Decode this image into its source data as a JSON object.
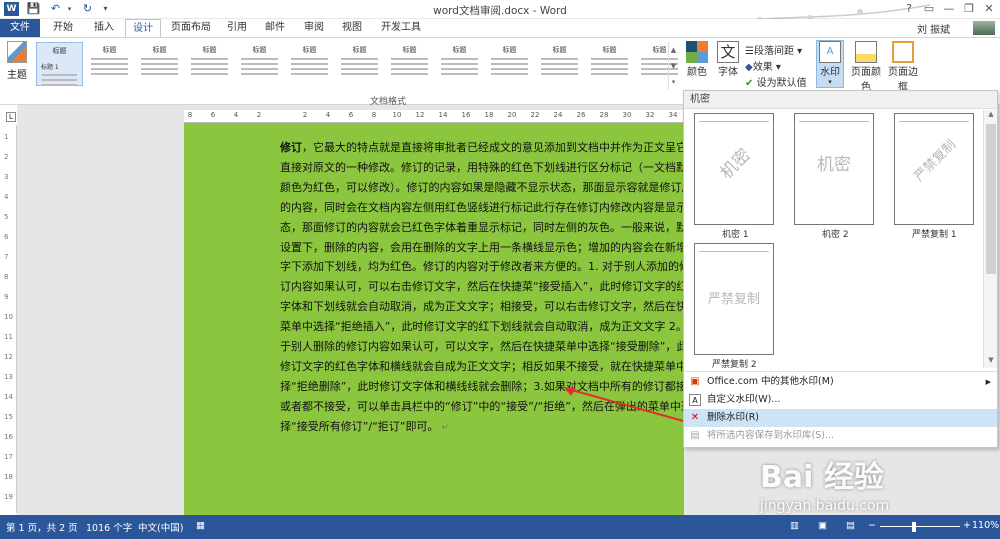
{
  "window": {
    "title": "word文档审阅.docx - Word",
    "controls": [
      "?",
      "▭",
      "—",
      "❐",
      "✕"
    ]
  },
  "tabs": [
    {
      "label": "文件"
    },
    {
      "label": "开始"
    },
    {
      "label": "插入"
    },
    {
      "label": "设计"
    },
    {
      "label": "页面布局"
    },
    {
      "label": "引用"
    },
    {
      "label": "邮件"
    },
    {
      "label": "审阅"
    },
    {
      "label": "视图"
    },
    {
      "label": "开发工具"
    }
  ],
  "user": {
    "name": "刘 振斌"
  },
  "ribbon": {
    "theme_label": "主题",
    "group_label": "文档格式",
    "style_thumbs": [
      "标题",
      "标题",
      "标题",
      "标题",
      "标题",
      "标题",
      "标题",
      "标题",
      "标题",
      "标题",
      "标题",
      "标题",
      "标题"
    ],
    "style_thumb_subtitle": "标题 1",
    "colors_label": "颜色",
    "fonts_label": "字体",
    "paragraph_spacing_label": "段落间距",
    "effects_label": "效果",
    "set_default_label": "设为默认值",
    "watermark_label": "水印",
    "page_color_label": "页面颜色",
    "page_border_label": "页面边框"
  },
  "ruler": {
    "ticks": [
      "8",
      "6",
      "4",
      "2",
      "",
      "2",
      "4",
      "6",
      "8",
      "10",
      "12",
      "14",
      "16",
      "18",
      "20",
      "22",
      "24",
      "26",
      "28",
      "30",
      "32",
      "34"
    ]
  },
  "vruler": {
    "ticks": [
      "1",
      "2",
      "3",
      "4",
      "5",
      "6",
      "7",
      "8",
      "9",
      "10",
      "11",
      "12",
      "13",
      "14",
      "15",
      "16",
      "17",
      "18",
      "19"
    ]
  },
  "document": {
    "lead": "修订",
    "body": "，它最大的特点就是直接将审批者已经成文的意见添加到文档中并作为正文呈它是直接对原文的一种修改。修订的记录，用特殊的红色下划线进行区分标记（一文档默认颜色为红色，可以修改）。修订的内容如果是隐藏不显示状态，那面显示容就是修订后的内容，同时会在文档内容左侧用红色竖线进行标记此行存在修订内修改内容是显示状态，那面修订的内容就会已红色字体着重显示标记，同时左侧的灰色。一般来说，默认设置下，删除的内容，会用在删除的文字上用一条横线显示色；增加的内容会在新增文字下添加下划线，均为红色。修订的内容对于修改者来方便的。1. 对于别人添加的修订内容如果认可，可以右击修订文字，然后在快捷菜“接受插入”，此时修订文字的红色字体和下划线就会自动取消，成为正文文字；相接受，可以右击修订文字，然后在快捷菜单中选择“拒绝插入”，此时修订文字的红下划线就会自动取消，成为正文文字 2。对于别人删除的修订内容如果认可，可以文字，然后在快捷菜单中选择“接受删除”，此时修订文字的红色字体和横线就会自成为正文文字；相反如果不接受，就在快捷菜单中选择“拒绝删除”，此时修订文字体和横线线就会删除；3.如果对文档中所有的修订都接受或者都不接受，可以单击具栏中的“修订”中的“接受”/“拒绝”，然后在弹出的菜单中选择“接受所有修订”/“拒订”即可。",
    "page_color": "#8cc63f"
  },
  "watermark_menu": {
    "header": "机密",
    "items": [
      {
        "thumb_text": "机密",
        "label": "机密 1"
      },
      {
        "thumb_text": "机密",
        "label": "机密 2"
      },
      {
        "thumb_text": "严禁复制",
        "label": "严禁复制 1"
      },
      {
        "thumb_text": "严禁复制",
        "label": "严禁复制 2"
      }
    ],
    "actions": [
      {
        "label": "Office.com 中的其他水印(M)",
        "icon": "office-icon",
        "arrow": "▶"
      },
      {
        "label": "自定义水印(W)...",
        "icon": "custom-watermark-icon"
      },
      {
        "label": "删除水印(R)",
        "icon": "remove-watermark-icon"
      },
      {
        "label": "将所选内容保存到水印库(S)...",
        "icon": "save-gallery-icon"
      }
    ]
  },
  "status": {
    "page": "第 1 页，共 2 页",
    "words": "1016 个字",
    "language": "中文(中国)",
    "zoom": "110%"
  },
  "baidu": {
    "brand": "Bai 经验",
    "url": "jingyan.baidu.com"
  },
  "colors": {
    "accent": "#2b579a",
    "highlight": "#cde3f6",
    "arrow": "#e0302a"
  }
}
